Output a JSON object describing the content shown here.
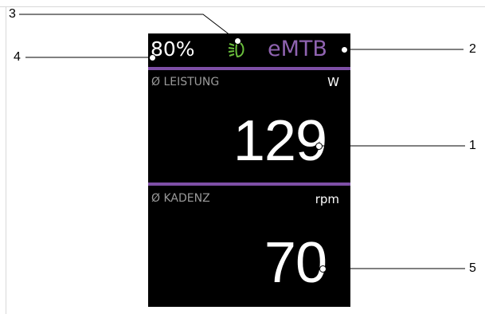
{
  "status_bar": {
    "battery_level": "80%",
    "light_icon": "headlight-icon",
    "mode": "eMTB"
  },
  "metrics": [
    {
      "label": "Ø LEISTUNG",
      "unit": "W",
      "value": "129"
    },
    {
      "label": "Ø KADENZ",
      "unit": "rpm",
      "value": "70"
    }
  ],
  "callouts": [
    "1",
    "2",
    "3",
    "4",
    "5"
  ],
  "colors": {
    "display_background": "#000000",
    "accent_purple": "#7e4fa6",
    "mode_text": "#8f63b0",
    "light_icon_green": "#6abf3c",
    "label_grey": "#9a9a9a"
  }
}
